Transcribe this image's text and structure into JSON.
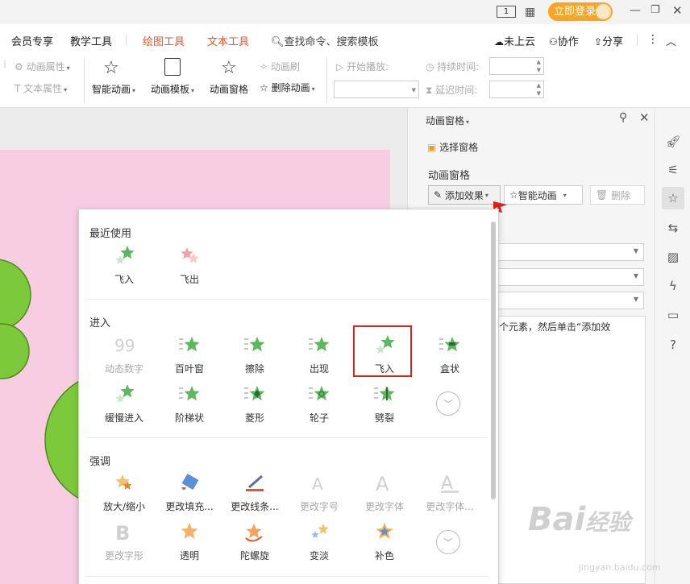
{
  "titlebar": {
    "badge": "1",
    "login_label": "立即登录"
  },
  "tabs": {
    "member": "会员专享",
    "teach": "教学工具",
    "draw": "绘图工具",
    "text": "文本工具",
    "search": "查找命令、搜索模板",
    "cloud": "未上云",
    "collab": "协作",
    "share": "分享"
  },
  "ribbon": {
    "anim_attr": "动画属性",
    "text_attr": "文本属性",
    "smart_anim": "智能动画",
    "anim_template": "动画模板",
    "anim_pane": "动画窗格",
    "anim_brush": "动画刷",
    "delete_anim": "删除动画",
    "start_play": "开始播放:",
    "duration": "持续时间:",
    "delay": "延迟时间:"
  },
  "pane": {
    "header": "动画窗格",
    "select_pane": "选择窗格",
    "section_title": "动画窗格",
    "add_effect": "添加效果",
    "smart_anim": "智能动画",
    "delete": "删除",
    "hint": "某个元素，然后单击“添加效"
  },
  "dropdown": {
    "recent_title": "最近使用",
    "recent": [
      {
        "label": "飞入",
        "icon": "fly-in-star-icon"
      },
      {
        "label": "飞出",
        "icon": "fly-out-star-icon"
      }
    ],
    "enter_title": "进入",
    "enter": [
      {
        "label": "动态数字",
        "icon": "dynamic-number-icon",
        "disabled": true
      },
      {
        "label": "百叶窗",
        "icon": "blinds-star-icon"
      },
      {
        "label": "擦除",
        "icon": "wipe-star-icon"
      },
      {
        "label": "出现",
        "icon": "appear-star-icon"
      },
      {
        "label": "飞入",
        "icon": "fly-in-star-icon"
      },
      {
        "label": "盒状",
        "icon": "box-star-icon"
      },
      {
        "label": "缓慢进入",
        "icon": "crawl-in-star-icon"
      },
      {
        "label": "阶梯状",
        "icon": "step-star-icon"
      },
      {
        "label": "菱形",
        "icon": "diamond-star-icon"
      },
      {
        "label": "轮子",
        "icon": "wheel-star-icon"
      },
      {
        "label": "劈裂",
        "icon": "split-star-icon"
      }
    ],
    "emphasis_title": "强调",
    "emphasis": [
      {
        "label": "放大/缩小",
        "icon": "grow-shrink-star-icon"
      },
      {
        "label": "更改填充...",
        "icon": "change-fill-icon"
      },
      {
        "label": "更改线条...",
        "icon": "change-line-icon"
      },
      {
        "label": "更改字号",
        "icon": "change-font-size-icon",
        "disabled": true
      },
      {
        "label": "更改字体",
        "icon": "change-font-icon",
        "disabled": true
      },
      {
        "label": "更改字体...",
        "icon": "change-font-color-icon",
        "disabled": true
      },
      {
        "label": "更改字形",
        "icon": "change-font-style-icon",
        "disabled": true
      },
      {
        "label": "透明",
        "icon": "transparency-star-icon"
      },
      {
        "label": "陀螺旋",
        "icon": "spin-star-icon"
      },
      {
        "label": "变淡",
        "icon": "fade-star-icon"
      },
      {
        "label": "补色",
        "icon": "complementary-color-star-icon"
      }
    ]
  },
  "watermark": {
    "brand": "Bai",
    "brand2": "经验",
    "url": "jingyan.baidu.com"
  },
  "colors": {
    "accent": "#e5562a",
    "star_green": "#5cb85c",
    "login_orange": "#f5a623",
    "highlight_red": "#d9251b",
    "slide_pink": "#f8cde2",
    "tree_green": "#7dc93c"
  }
}
